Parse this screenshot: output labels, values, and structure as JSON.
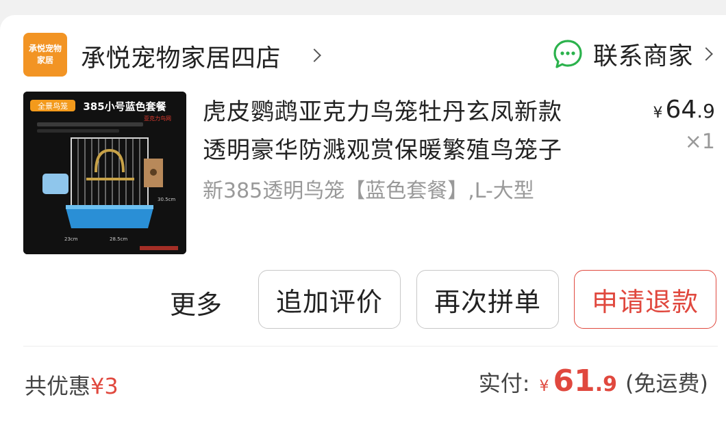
{
  "shop": {
    "logo_line1": "承悦宠物",
    "logo_line2": "家居",
    "name": "承悦宠物家居四店",
    "contact_label": "联系商家"
  },
  "product": {
    "title_line1": "虎皮鹦鹉亚克力鸟笼牡丹玄凤新款",
    "title_line2": "透明豪华防溅观赏保暖繁殖鸟笼子",
    "sku": "新385透明鸟笼【蓝色套餐】,L-大型",
    "price_symbol": "¥",
    "price_int": "64",
    "price_dec": ".9",
    "quantity": "×1",
    "image": {
      "badge": "全景鸟笼",
      "heading": "385小号蓝色套餐",
      "subheading": "亚克力鸟网",
      "dim_height": "30.5cm",
      "dim_depth": "23cm",
      "dim_width": "28.5cm"
    }
  },
  "actions": {
    "more_label": "更多",
    "review_label": "追加评价",
    "rebuy_label": "再次拼单",
    "refund_label": "申请退款"
  },
  "footer": {
    "discount_label": "共优惠",
    "discount_amount": "¥3",
    "paid_label": "实付:",
    "paid_symbol": "¥",
    "paid_int": "61",
    "paid_dec": ".9",
    "shipping_note": "(免运费)"
  },
  "colors": {
    "accent_red": "#e0483e",
    "chat_green": "#2bb24c",
    "logo_orange": "#f29424"
  }
}
